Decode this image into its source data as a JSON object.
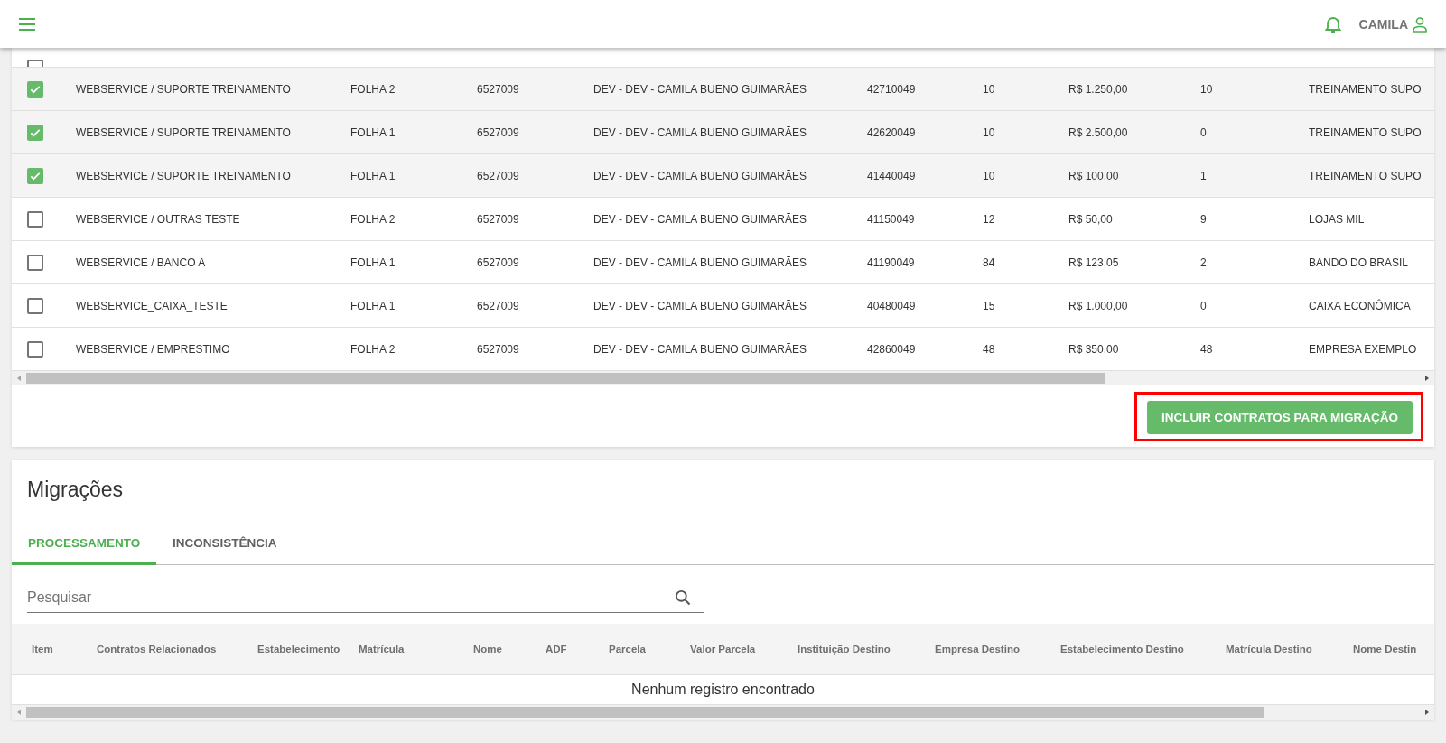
{
  "header": {
    "user": "CAMILA"
  },
  "contracts": {
    "top_row": {
      "checked": false
    },
    "rows": [
      {
        "checked": true,
        "cells": [
          "WEBSERVICE / SUPORTE TREINAMENTO",
          "FOLHA 2",
          "6527009",
          "DEV - DEV - CAMILA BUENO GUIMARÃES",
          "42710049",
          "10",
          "R$ 1.250,00",
          "10",
          "TREINAMENTO SUPO"
        ]
      },
      {
        "checked": true,
        "cells": [
          "WEBSERVICE / SUPORTE TREINAMENTO",
          "FOLHA 1",
          "6527009",
          "DEV - DEV - CAMILA BUENO GUIMARÃES",
          "42620049",
          "10",
          "R$ 2.500,00",
          "0",
          "TREINAMENTO SUPO"
        ]
      },
      {
        "checked": true,
        "cells": [
          "WEBSERVICE / SUPORTE TREINAMENTO",
          "FOLHA 1",
          "6527009",
          "DEV - DEV - CAMILA BUENO GUIMARÃES",
          "41440049",
          "10",
          "R$ 100,00",
          "1",
          "TREINAMENTO SUPO"
        ]
      },
      {
        "checked": false,
        "cells": [
          "WEBSERVICE / OUTRAS TESTE",
          "FOLHA 2",
          "6527009",
          "DEV - DEV - CAMILA BUENO GUIMARÃES",
          "41150049",
          "12",
          "R$ 50,00",
          "9",
          "LOJAS MIL"
        ]
      },
      {
        "checked": false,
        "cells": [
          "WEBSERVICE / BANCO A",
          "FOLHA 1",
          "6527009",
          "DEV - DEV - CAMILA BUENO GUIMARÃES",
          "41190049",
          "84",
          "R$ 123,05",
          "2",
          "BANDO DO BRASIL"
        ]
      },
      {
        "checked": false,
        "cells": [
          "WEBSERVICE_CAIXA_TESTE",
          "FOLHA 1",
          "6527009",
          "DEV - DEV - CAMILA BUENO GUIMARÃES",
          "40480049",
          "15",
          "R$ 1.000,00",
          "0",
          "CAIXA ECONÔMICA"
        ]
      },
      {
        "checked": false,
        "cells": [
          "WEBSERVICE / EMPRESTIMO",
          "FOLHA 2",
          "6527009",
          "DEV - DEV - CAMILA BUENO GUIMARÃES",
          "42860049",
          "48",
          "R$ 350,00",
          "48",
          "EMPRESA EXEMPLO"
        ]
      }
    ],
    "button": "INCLUIR CONTRATOS PARA MIGRAÇÃO"
  },
  "migrations": {
    "title": "Migrações",
    "tabs": [
      {
        "label": "PROCESSAMENTO",
        "selected": true
      },
      {
        "label": "INCONSISTÊNCIA",
        "selected": false
      }
    ],
    "search": {
      "placeholder": "Pesquisar"
    },
    "table": {
      "columns": [
        "Item",
        "Contratos Relacionados",
        "Estabelecimento",
        "Matrícula",
        "Nome",
        "ADF",
        "Parcela",
        "Valor Parcela",
        "Instituição Destino",
        "Empresa Destino",
        "Estabelecimento Destino",
        "Matrícula Destino",
        "Nome Destin"
      ],
      "empty": "Nenhum registro encontrado"
    }
  }
}
